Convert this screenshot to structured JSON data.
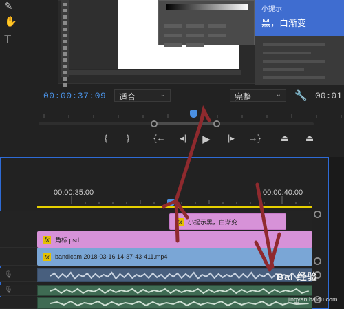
{
  "monitor": {
    "timecode": "00:00:37:09",
    "fit_value": "适合",
    "quality_value": "完整",
    "duration": "00:01:",
    "tip_title": "小提示",
    "tip_text": "黑，白渐变"
  },
  "timeline": {
    "ruler_labels": [
      "00:00:35:00",
      "00:00:40:00"
    ],
    "work_area_color": "#e6d000",
    "playhead_color": "#4a90e2",
    "tracks": [
      {
        "clip_label": "小提示黑，白渐变",
        "color": "#d792d8"
      },
      {
        "clip_label": "角标.psd",
        "color": "#d792d8"
      },
      {
        "clip_label": "bandicam 2018-03-16 14-37-43-411.mp4",
        "color": "#7aa6d6"
      }
    ],
    "fx_label": "fx",
    "audio_track_colors": [
      "#485f7e",
      "#3f6b53",
      "#3f6b53"
    ]
  },
  "annotation": {
    "arrow_color": "#8f2a2e"
  },
  "watermark": {
    "logo": "Bai 经验",
    "url": "jingyan.baidu.com"
  }
}
